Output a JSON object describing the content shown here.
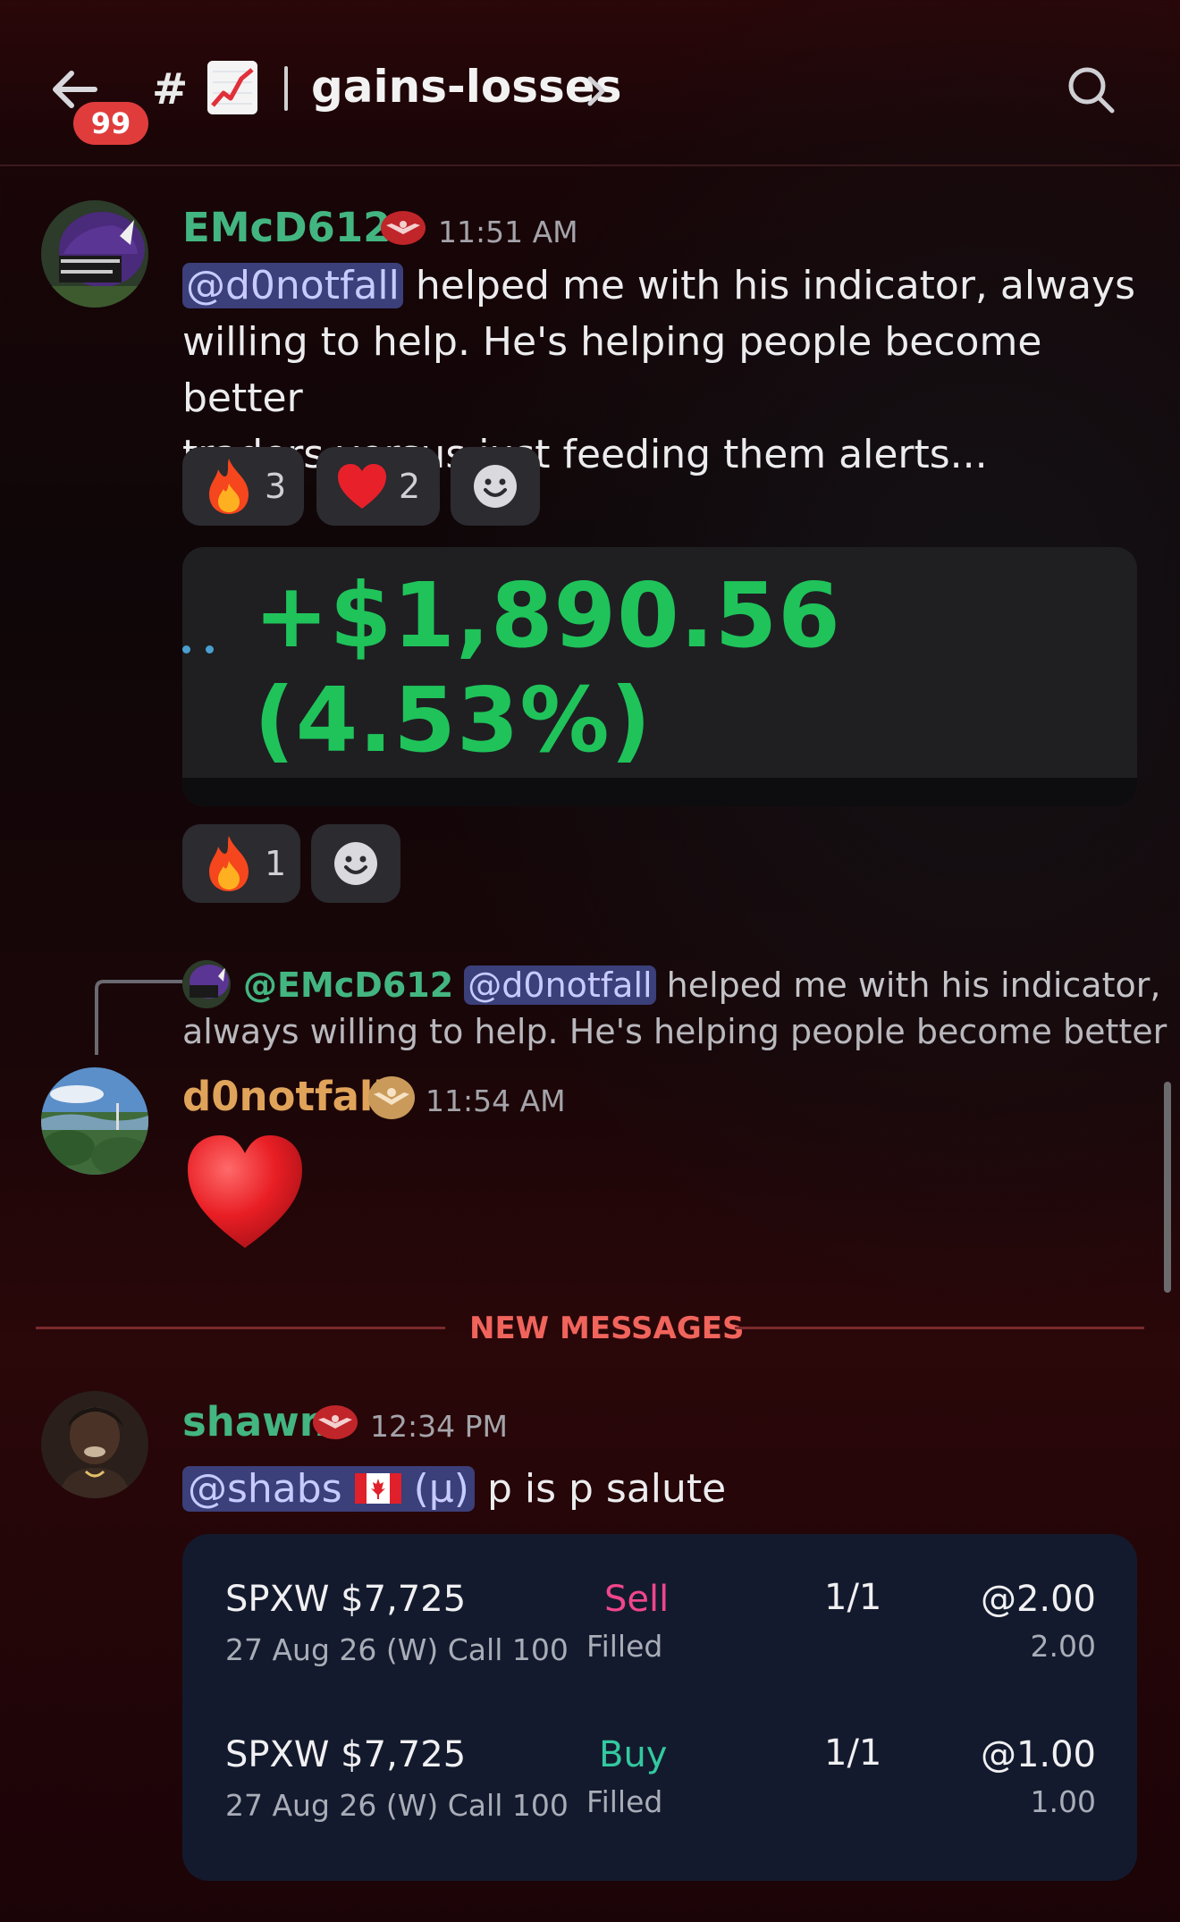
{
  "header": {
    "unread_badge": "99",
    "hash": "#",
    "channel_name": "gains-losses",
    "icons": [
      "back-arrow-icon",
      "chart-emoji-icon",
      "chevron-right-icon",
      "search-icon"
    ]
  },
  "messages": [
    {
      "author": "EMcD612",
      "author_color": "#43b581",
      "time": "11:51 AM",
      "mention": "@d0notfall",
      "lines": [
        " helped me with his indicator, always",
        "willing to help. He's helping people become better",
        "traders versus just feeding them alerts..."
      ],
      "reactions": [
        {
          "emoji": "fire",
          "count": "3"
        },
        {
          "emoji": "heart",
          "count": "2"
        }
      ],
      "image_text": "+$1,890.56 (4.53%)",
      "image_reactions": [
        {
          "emoji": "fire",
          "count": "1"
        }
      ]
    },
    {
      "reply_to_author": "@EMcD612",
      "reply_mention": "@d0notfall",
      "reply_line1": " helped me with his indicator,",
      "reply_line2": "always willing to help. He's helping people become better ...",
      "author": "d0notfall",
      "author_color": "#e0a35a",
      "time": "11:54 AM",
      "content_emoji": "heart"
    },
    {
      "divider": "NEW MESSAGES",
      "author": "shawn",
      "author_color": "#43b581",
      "time": "12:34 PM",
      "mention": "@shabs",
      "mention_suffix": " (μ)",
      "text": " p is p salute",
      "trades": [
        {
          "symbol": "SPXW $7,725",
          "detail": "27 Aug 26 (W) Call 100",
          "side": "Sell",
          "side_color": "#f0468c",
          "status": "Filled",
          "qty": "1/1",
          "price": "@2.00",
          "fill": "2.00"
        },
        {
          "symbol": "SPXW $7,725",
          "detail": "27 Aug 26 (W) Call 100",
          "side": "Buy",
          "side_color": "#33c9a0",
          "status": "Filled",
          "qty": "1/1",
          "price": "@1.00",
          "fill": "1.00"
        }
      ]
    }
  ]
}
